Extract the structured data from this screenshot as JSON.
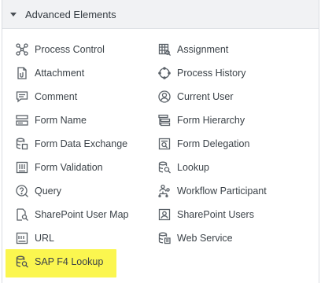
{
  "panel": {
    "title": "Advanced Elements",
    "highlight_color": "#fbf64f"
  },
  "left_items": [
    {
      "label": "Process Control",
      "icon": "network-nodes-icon"
    },
    {
      "label": "Attachment",
      "icon": "paperclip-document-icon"
    },
    {
      "label": "Comment",
      "icon": "comment-icon"
    },
    {
      "label": "Form Name",
      "icon": "form-name-icon"
    },
    {
      "label": "Form Data Exchange",
      "icon": "database-exchange-icon"
    },
    {
      "label": "Form Validation",
      "icon": "form-validation-icon"
    },
    {
      "label": "Query",
      "icon": "query-icon"
    },
    {
      "label": "SharePoint User Map",
      "icon": "user-map-icon"
    },
    {
      "label": "URL",
      "icon": "url-icon"
    },
    {
      "label": "SAP F4 Lookup",
      "icon": "sap-lookup-icon"
    }
  ],
  "right_items": [
    {
      "label": "Assignment",
      "icon": "assignment-icon"
    },
    {
      "label": "Process History",
      "icon": "process-history-icon"
    },
    {
      "label": "Current User",
      "icon": "current-user-icon"
    },
    {
      "label": "Form Hierarchy",
      "icon": "hierarchy-icon"
    },
    {
      "label": "Form Delegation",
      "icon": "delegation-icon"
    },
    {
      "label": "Lookup",
      "icon": "lookup-icon"
    },
    {
      "label": "Workflow Participant",
      "icon": "workflow-participant-icon"
    },
    {
      "label": "SharePoint Users",
      "icon": "sharepoint-users-icon"
    },
    {
      "label": "Web Service",
      "icon": "web-service-icon"
    }
  ]
}
